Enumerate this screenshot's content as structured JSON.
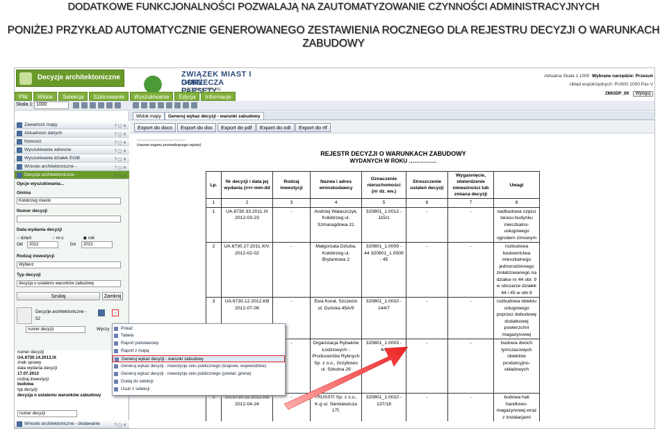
{
  "slide": {
    "title": "DODATKOWE FUNKCJONALNOŚCI POZWALAJĄ NA ZAUTOMATYZOWANIE CZYNNOŚCI ADMINISTRACYJNYCH",
    "subtitle_line1": "PONIŻEJ PRZYKŁAD AUTOMATYCZNIE GENEROWANEGO ZESTAWIENIA ROCZNEGO DLA  REJESTRU DECYZJI O WARUNKACH",
    "subtitle_line2": "ZABUDOWY"
  },
  "app": {
    "module_title": "Decyzje architektoniczne",
    "org_line1": "ZWIĄZEK MIAST I GMIN",
    "org_line2": "DORZECZA PARSĘTY",
    "org_line3": "Z SIEDZIBĄ W KARLINIE",
    "scale_text": "Aktualna Skala 1:1000",
    "tool_text": "Wybrane narzędzie: Przesuń",
    "coord_text": "Układ współrzędnych: PUWG 2000 Pas V",
    "user": "ZMIGDP_SK",
    "logout": "Wyloguj",
    "menu": [
      "Plik",
      "Widok",
      "Selekcja",
      "Szkicowanie",
      "Wyszukiwanie",
      "Edycja",
      "Informacje"
    ]
  },
  "toolbar": {
    "scale_label": "Skala 1:",
    "scale_value": "1000"
  },
  "left": {
    "items": [
      "Zawartość mapy",
      "Aktualność danych",
      "Nowości",
      "Wyszukiwanie adresów",
      "Wyszukiwanie działek EGiB",
      "Wnioski architektoniczne -",
      "Decyzje architektoniczne -"
    ],
    "options_label": "Opcje wyszukiwania...",
    "gmina_label": "Gmina",
    "gmina_value": "Kołobrzeg miasto",
    "numer_label": "Numer decyzji",
    "numer_value": "",
    "data_label": "Data wydania decyzji",
    "radio_day": "dzień",
    "radio_month": "m-c",
    "radio_year": "rok",
    "od_label": "Od",
    "od_value": "2012",
    "do_label": "Do",
    "do_value": "2013",
    "rodzaj_label": "Rodzaj inwestycji",
    "rodzaj_value": "Wybierz",
    "typ_label": "Typ decyzji",
    "typ_value": "decyzja o ustaleniu warunków zabudowy",
    "search_btn": "Szukaj",
    "close_btn": "Zamknij",
    "result_title": "Decyzje architektoniczne -",
    "result_count": "52",
    "sort_value": "numer decyzji",
    "sort_btn": "Wyczy",
    "details": [
      "numer decyzji",
      "UA.6730.14.2013.IX",
      "znak sprawy",
      "data wydania decyzji",
      "17.07.2013",
      "rodzaj inwestycji",
      "budowa",
      "typ decyzji",
      "decyzja o ustaleniu warunków zabudowy"
    ],
    "bottom_sort": "numer decyzji",
    "bottom_panel": "Wnioski architektoniczne - dodawanie"
  },
  "doc": {
    "tabs": [
      "Widok mapy",
      "Generuj wykaz decyzji - warunki zabudowy"
    ],
    "export_buttons": [
      "Export do docx",
      "Export do doc",
      "Export do pdf",
      "Export do odt",
      "Export do rtf"
    ],
    "dots": "..........................................",
    "organ": "(nazwa organu prowadzącego rejestr)",
    "title1": "REJESTR DECYZJI O WARUNKACH ZABUDOWY",
    "title2": "WYDANYCH W ROKU ……………",
    "headers": [
      "Lp.",
      "Nr decyzji i data jej wydania (rrrr-mm-dd",
      "Rodzaj inwestycji",
      "Nazwa i adres wnioskodawcy",
      "Oznaczenie nieruchomości (nr dz. ew.)",
      "Streszczenie ustaleń decyzji",
      "Wygaśnięcie, stwierdzenie nieważności lub zmiana decyzji",
      "Uwagi"
    ],
    "col_numbers": [
      "1",
      "2",
      "3",
      "4",
      "5",
      "6",
      "7",
      "8"
    ],
    "rows": [
      {
        "lp": "1",
        "nr": "UA.6730.33.2011.IX 2012-03-23",
        "rodzaj": "-",
        "nazwa": "Andrzej Walaszczyk, Kołobrzeg ul. Szmaragdowa 21",
        "ozn": "320801_1.0012 - 115/1",
        "stresz": "-",
        "wyg": "-",
        "uwagi": "nadbudowa części tarasu budynku mieszkalno-usługowego ogrodem zimowym"
      },
      {
        "lp": "2",
        "nr": "UA.6730.27.2011.XIV. 2012-02-02",
        "rodzaj": "-",
        "nazwa": "Małgorzata Dziuba, Kołobrzeg ul. Brylantowa 2",
        "ozn": "320801_1.0009 - 44  320801_1.0009 - 45",
        "stresz": "-",
        "wyg": "-",
        "uwagi": "rozbudowa budownictwa mieszkalnego jednorodzinnego ziołalizowanego na działce nr 44 obr. 9 w obszarze działek 44 i 45 w obr.9"
      },
      {
        "lp": "3",
        "nr": "UA.6730.12.2012.KB 2012-07-06",
        "rodzaj": "-",
        "nazwa": "Ewa Koral, Szczecin ul. Duńska 45A/9",
        "ozn": "320801_1.0010 - 144/7",
        "stresz": "-",
        "wyg": "-",
        "uwagi": "rozbudowa obiektu usługowego poprzez dobudowę dodatkowej powierzchni magazynowej"
      },
      {
        "lp": "4",
        "nr": "",
        "rodzaj": "-",
        "nazwa": "Organizacja Rybaków Łodziowych - Producentów Rybnych Sp. z o.o., Grzybowo ul. Szkolna 29",
        "ozn": "320801_1.0003 - 4/9",
        "stresz": "-",
        "wyg": "-",
        "uwagi": "budowa dwóch tymczasowych obiektów produkcyjno-składowych"
      },
      {
        "lp": "5",
        "nr": "UA.6730.32.2012.KB 2012-04-24",
        "rodzaj": "-",
        "nazwa": "TRUSSTI Sp. z o.o., K-g ul. Sienkiewicza 17f,",
        "ozn": "320801_1.0010 - 137/18",
        "stresz": "-",
        "wyg": "-",
        "uwagi": "budowa hali handlowo-magazynowej wraz z instalacjami"
      }
    ]
  },
  "popup": {
    "items": [
      "Pokaż",
      "Tabela",
      "Raport podstawowy",
      "Raport z mapą",
      "Generuj wykaz decyzji - warunki zabudowy",
      "Generuj wykaz decyzji - inwestycje celu publicznego (krajowe, wojewódzkie)",
      "Generuj wykaz decyzji - inwestycje celu publicznego (powiat, gmina)",
      "Dodaj do selekcji",
      "Usuń z selekcji"
    ]
  },
  "colors": {
    "accent_green": "#6a9a2a",
    "highlight_red": "#dd2222"
  }
}
